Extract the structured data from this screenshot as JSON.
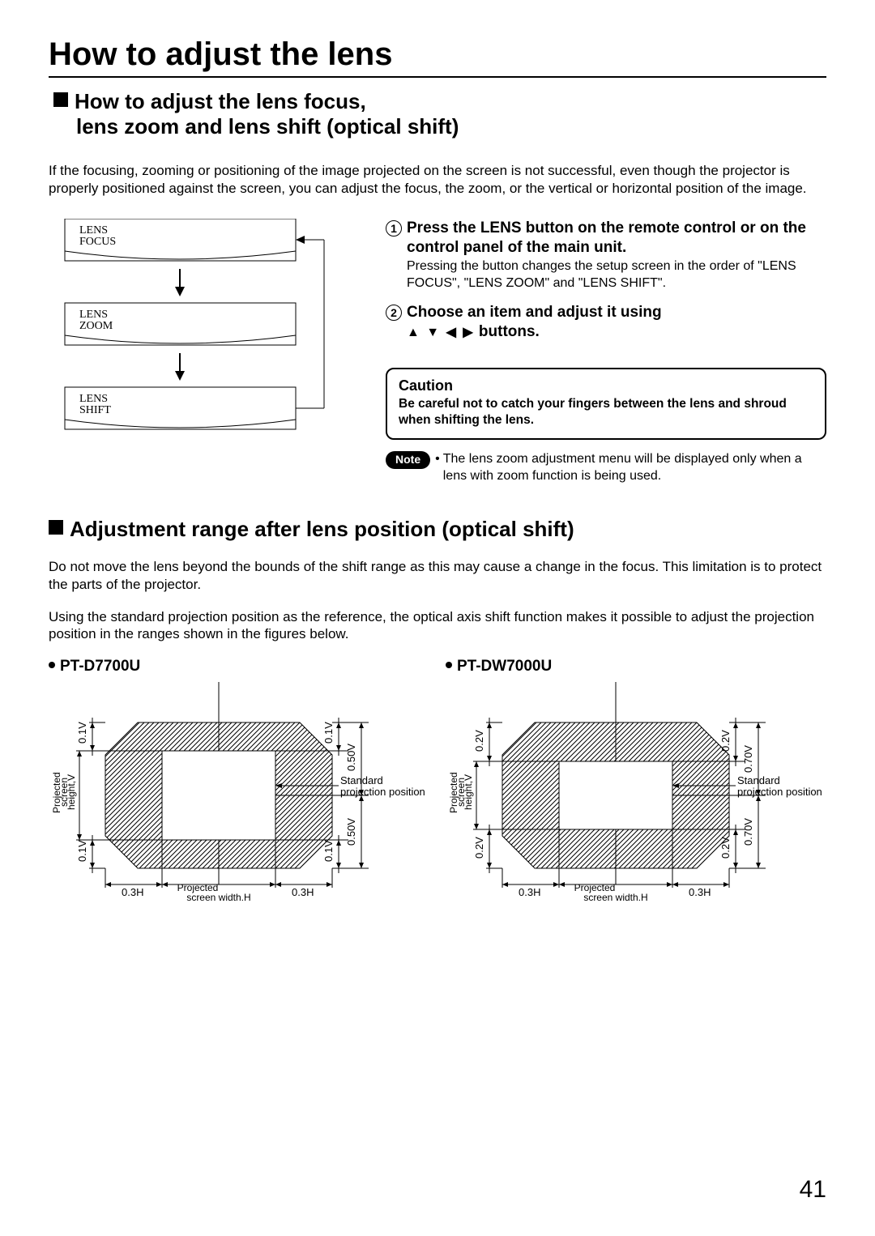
{
  "title": "How to adjust the lens",
  "section1": {
    "heading_line1": "How to adjust the lens focus,",
    "heading_line2": "lens zoom and lens shift (optical shift)",
    "intro": "If the focusing, zooming or positioning of the image projected on the screen is not successful, even though the projector is properly positioned against the screen, you can adjust the focus, the zoom, or the vertical or horizontal position of the image."
  },
  "flow": {
    "box1_label": "LENS\nFOCUS",
    "box2_label": "LENS\nZOOM",
    "box3_label": "LENS\nSHIFT"
  },
  "steps": {
    "s1_title": "Press the LENS button on the remote control or on the control panel of the main unit.",
    "s1_body": "Pressing the button changes the setup screen in the order of \"LENS FOCUS\", \"LENS ZOOM\" and \"LENS SHIFT\".",
    "s2_title_a": "Choose an item and adjust it using ",
    "s2_title_b": " buttons."
  },
  "caution": {
    "title": "Caution",
    "body": "Be careful not to catch your fingers between the lens and shroud when shifting the lens."
  },
  "note": {
    "pill": "Note",
    "text": "The lens zoom adjustment menu will be displayed only when a lens with zoom function is being used."
  },
  "section2": {
    "heading": "Adjustment range after lens position (optical shift)",
    "p1": "Do not move the lens beyond the bounds of the shift range as this may cause a change in the focus. This limitation is to protect the parts of the projector.",
    "p2": "Using the standard projection position as the reference, the optical axis shift function makes it possible to adjust the projection position in the ranges shown in the figures below."
  },
  "models": {
    "m1": {
      "title": "PT-D7700U",
      "top_left_v": "0.1V",
      "top_right_v": "0.1V",
      "top_right_half": "0.50V",
      "bot_left_v": "0.1V",
      "bot_right_v": "0.1V",
      "bot_right_half": "0.50V",
      "left_h": "0.3H",
      "right_h": "0.3H",
      "screen_h": "Projected\nscreen width,H",
      "screen_v": "Projected\nscreen\nheight,V",
      "std": "Standard\nprojection position"
    },
    "m2": {
      "title": "PT-DW7000U",
      "top_left_v": "0.2V",
      "top_right_v": "0.2V",
      "top_right_half": "0.70V",
      "bot_left_v": "0.2V",
      "bot_right_v": "0.2V",
      "bot_right_half": "0.70V",
      "left_h": "0.3H",
      "right_h": "0.3H",
      "screen_h": "Projected\nscreen width,H",
      "screen_v": "Projected\nscreen\nheight,V",
      "std": "Standard\nprojection position"
    }
  },
  "page_number": "41"
}
